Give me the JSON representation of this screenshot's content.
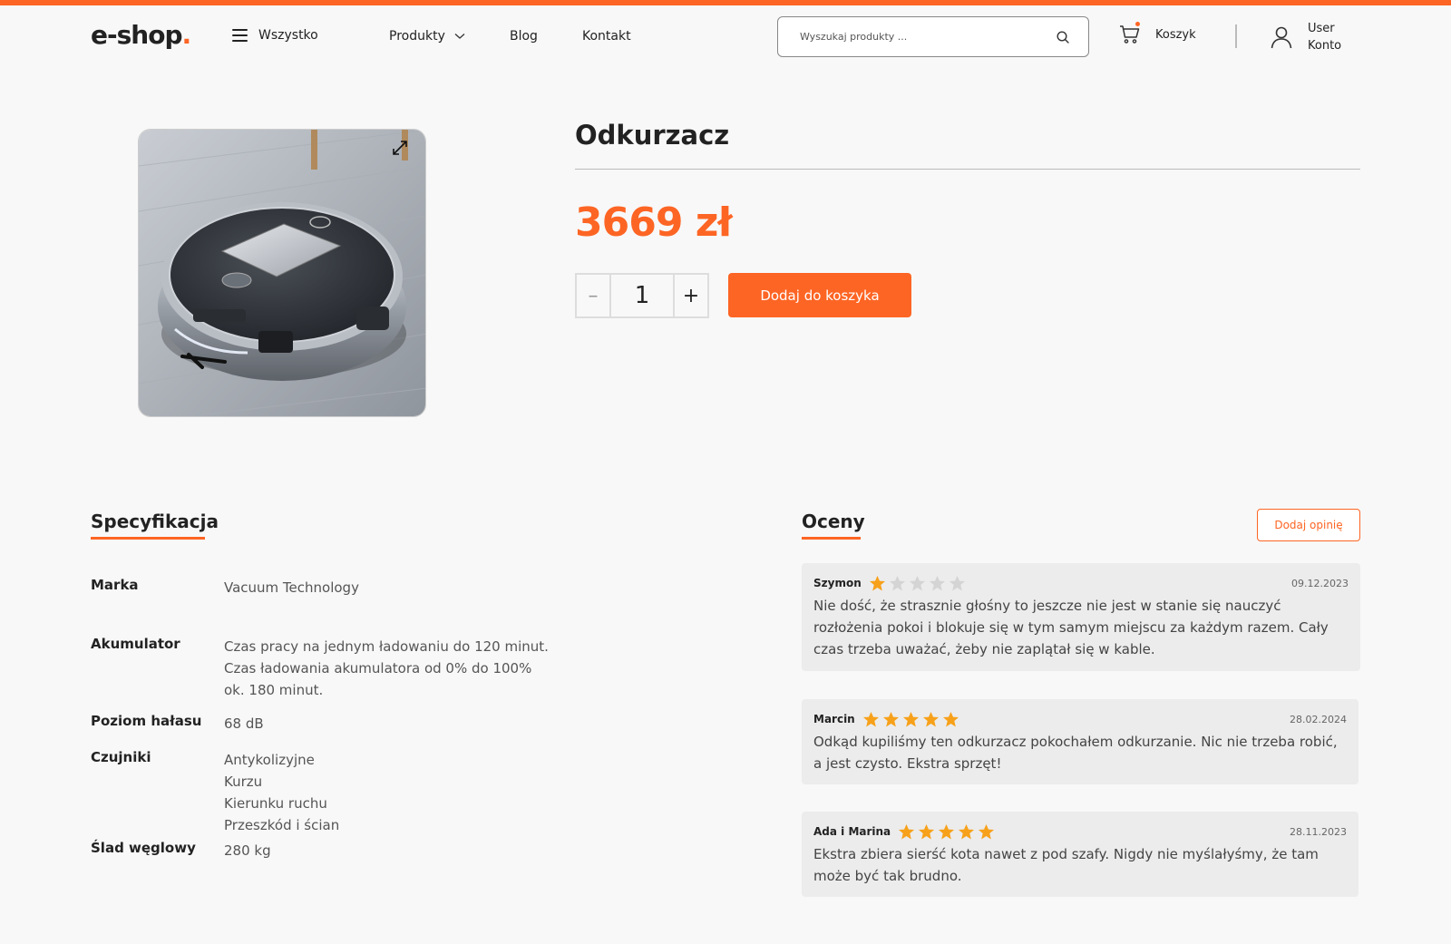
{
  "brand": {
    "logo_main": "e-shop",
    "logo_dot": "."
  },
  "nav": {
    "all_label": "Wszystko",
    "products_label": "Produkty",
    "blog_label": "Blog",
    "contact_label": "Kontakt"
  },
  "search": {
    "placeholder": "Wyszukaj produkty ...",
    "value": ""
  },
  "cart": {
    "label": "Koszyk"
  },
  "account": {
    "line1": "User",
    "line2": "Konto"
  },
  "product": {
    "title": "Odkurzacz",
    "price": "3669 zł",
    "quantity": "1",
    "minus_label": "–",
    "plus_label": "+",
    "add_to_cart_label": "Dodaj do koszyka"
  },
  "spec": {
    "title": "Specyfikacja",
    "rows": [
      {
        "key": "Marka",
        "values": [
          "Vacuum Technology"
        ]
      },
      {
        "key": "Akumulator",
        "values": [
          "Czas pracy na jednym ładowaniu do 120 minut.",
          "Czas ładowania akumulatora od 0% do 100%",
          "ok. 180 minut."
        ]
      },
      {
        "key": "Poziom hałasu",
        "values": [
          "68 dB"
        ]
      },
      {
        "key": "Czujniki",
        "values": [
          "Antykolizyjne",
          "Kurzu",
          "Kierunku ruchu",
          "Przeszkód i ścian"
        ]
      },
      {
        "key": "Ślad węglowy",
        "values": [
          "280 kg"
        ]
      }
    ]
  },
  "reviews": {
    "title": "Oceny",
    "add_label": "Dodaj opinię",
    "items": [
      {
        "author": "Szymon",
        "rating": 1,
        "max_rating": 5,
        "date": "09.12.2023",
        "text": "Nie dość, że strasznie głośny to jeszcze nie jest w stanie się nauczyć rozłożenia pokoi i blokuje się w tym samym miejscu za każdym razem. Cały czas trzeba uważać, żeby nie zaplątał się w kable."
      },
      {
        "author": "Marcin",
        "rating": 5,
        "max_rating": 5,
        "date": "28.02.2024",
        "text": "Odkąd kupiliśmy ten odkurzacz pokochałem odkurzanie. Nic nie trzeba robić, a jest czysto. Ekstra sprzęt!"
      },
      {
        "author": "Ada i Marina",
        "rating": 5,
        "max_rating": 5,
        "date": "28.11.2023",
        "text": "Ekstra zbiera sierść kota nawet z pod szafy. Nigdy nie myślałyśmy, że tam może być tak brudno."
      }
    ]
  },
  "colors": {
    "accent": "#fd6524",
    "star_filled": "#f7a11a",
    "star_empty": "#d4d4d4"
  }
}
